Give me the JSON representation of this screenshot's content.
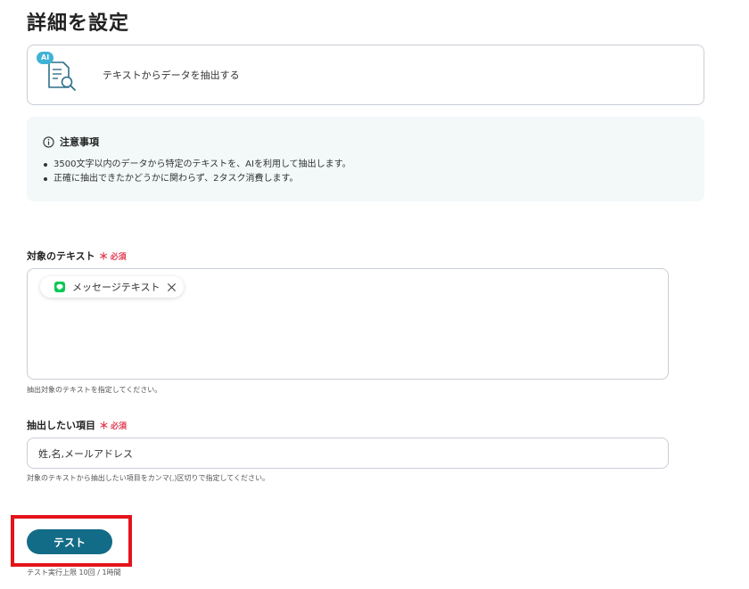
{
  "page": {
    "title": "詳細を設定"
  },
  "action": {
    "badge": "AI",
    "label": "テキストからデータを抽出する",
    "icon": "document-search-icon"
  },
  "notice": {
    "heading": "注意事項",
    "items": [
      "3500文字以内のデータから特定のテキストを、AIを利用して抽出します。",
      "正確に抽出できたかどうかに関わらず、2タスク消費します。"
    ]
  },
  "fields": {
    "target_text": {
      "label": "対象のテキスト",
      "required_mark": "＊",
      "required_text": "必須",
      "chip_label": "メッセージテキスト",
      "chip_icon": "line-app-icon",
      "help": "抽出対象のテキストを指定してください。"
    },
    "extract_items": {
      "label": "抽出したい項目",
      "required_mark": "＊",
      "required_text": "必須",
      "value": "姓,名,メールアドレス",
      "help": "対象のテキストから抽出したい項目をカンマ(,)区切りで指定してください。"
    }
  },
  "test": {
    "button_label": "テスト",
    "limit": "テスト実行上限 10回 / 1時間"
  },
  "colors": {
    "accent": "#136c87",
    "required": "#e03e52",
    "highlight": "#e3141a",
    "notice_bg": "#f3f8f9",
    "line_green": "#06c755",
    "ai_badge": "#3fb2d6"
  }
}
